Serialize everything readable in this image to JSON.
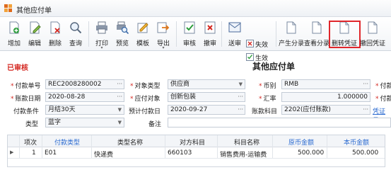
{
  "window": {
    "title": "其他应付单"
  },
  "toolbar": {
    "buttons": [
      {
        "label": "增加"
      },
      {
        "label": "编辑"
      },
      {
        "label": "删除"
      },
      {
        "label": "查询"
      },
      {
        "label": "打印"
      },
      {
        "label": "预览"
      },
      {
        "label": "模板"
      },
      {
        "label": "导出"
      },
      {
        "label": "审核"
      },
      {
        "label": "撤审"
      },
      {
        "label": "送审"
      },
      {
        "label": "产生分录"
      },
      {
        "label": "查看分录"
      },
      {
        "label": "删转凭证"
      },
      {
        "label": "撤回凭证"
      }
    ],
    "small": [
      {
        "label": "失效"
      },
      {
        "label": "生效"
      }
    ],
    "dropdown_caret": "▾"
  },
  "status": "已审核",
  "doc_title": "其他应付单",
  "form": {
    "labels": {
      "pay_no": "付款单号",
      "obj_type": "对象类型",
      "currency": "币别",
      "pay_cut": "付款",
      "pay_date": "账款日期",
      "pay_obj": "应付对象",
      "rate": "汇率",
      "pay_dept": "付款部",
      "terms": "付款条件",
      "due_date": "预计付款日",
      "account": "账款科目",
      "type": "类型",
      "note": "备注"
    },
    "values": {
      "pay_no": "REC2008280002",
      "obj_type": "供应商",
      "currency": "RMB",
      "pay_date": "2020-08-28",
      "pay_obj": "创新包装",
      "rate": "1.000000",
      "terms": "月结30天",
      "due_date": "2020-09-27",
      "account": "2202(应付账款)",
      "type": "蓝字",
      "note": ""
    },
    "link": "凭证号"
  },
  "grid": {
    "headers": [
      "项次",
      "付款类型",
      "类型名称",
      "对方科目",
      "科目名称",
      "原币金额",
      "本币金额"
    ],
    "rows": [
      {
        "seq": "1",
        "pay_type": "E01",
        "type_name": "快递费",
        "account": "660103",
        "account_name": "销售费用-运输费",
        "orig_amount": "500.000",
        "local_amount": "500.000"
      }
    ]
  }
}
